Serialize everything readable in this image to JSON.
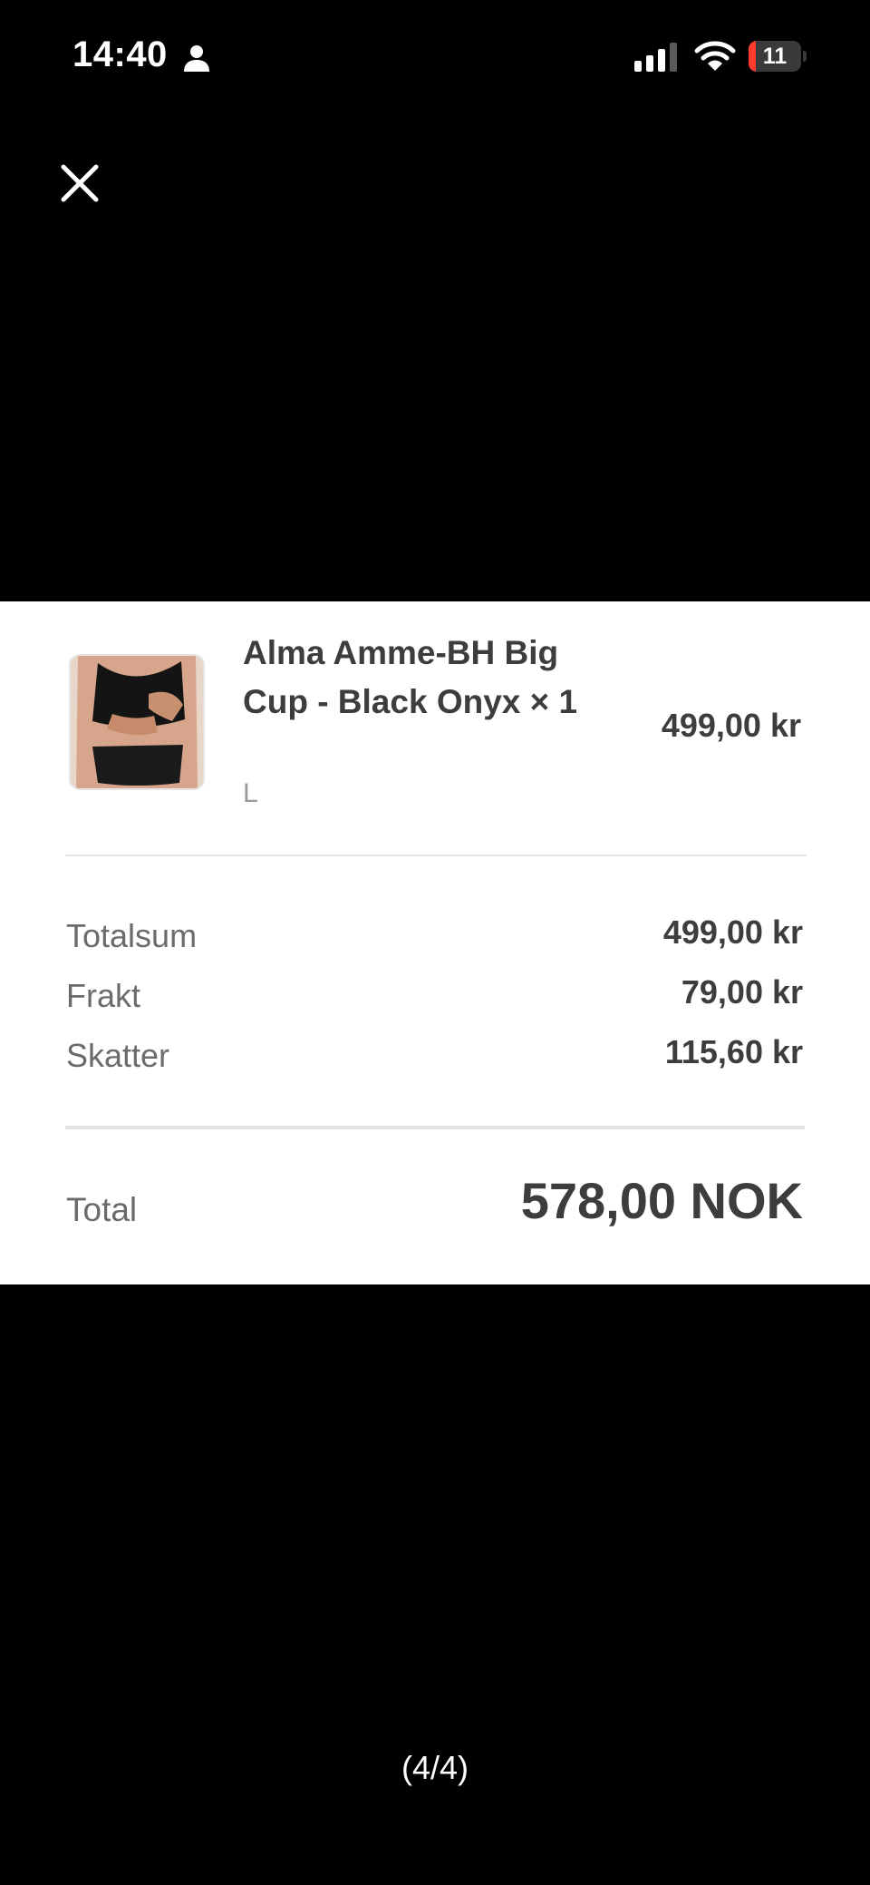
{
  "status_bar": {
    "time": "14:40",
    "battery_level": "11",
    "icons": [
      "person-icon",
      "cellular-signal-icon",
      "wifi-icon",
      "battery-icon"
    ]
  },
  "toolbar": {
    "close_icon": "close-icon"
  },
  "receipt": {
    "item": {
      "title": "Alma Amme-BH Big Cup - Black Onyx × 1",
      "variant": "L",
      "price": "499,00 kr"
    },
    "summary": [
      {
        "label": "Totalsum",
        "value": "499,00 kr"
      },
      {
        "label": "Frakt",
        "value": "79,00 kr"
      },
      {
        "label": "Skatter",
        "value": "115,60 kr"
      }
    ],
    "total": {
      "label": "Total",
      "value": "578,00 NOK"
    }
  },
  "pager": {
    "indicator": "(4/4)"
  },
  "colors": {
    "background": "#000000",
    "card": "#ffffff",
    "text_dark": "#3d3d3d",
    "text_muted": "#6b6b6b",
    "battery_low": "#ff3b30"
  }
}
